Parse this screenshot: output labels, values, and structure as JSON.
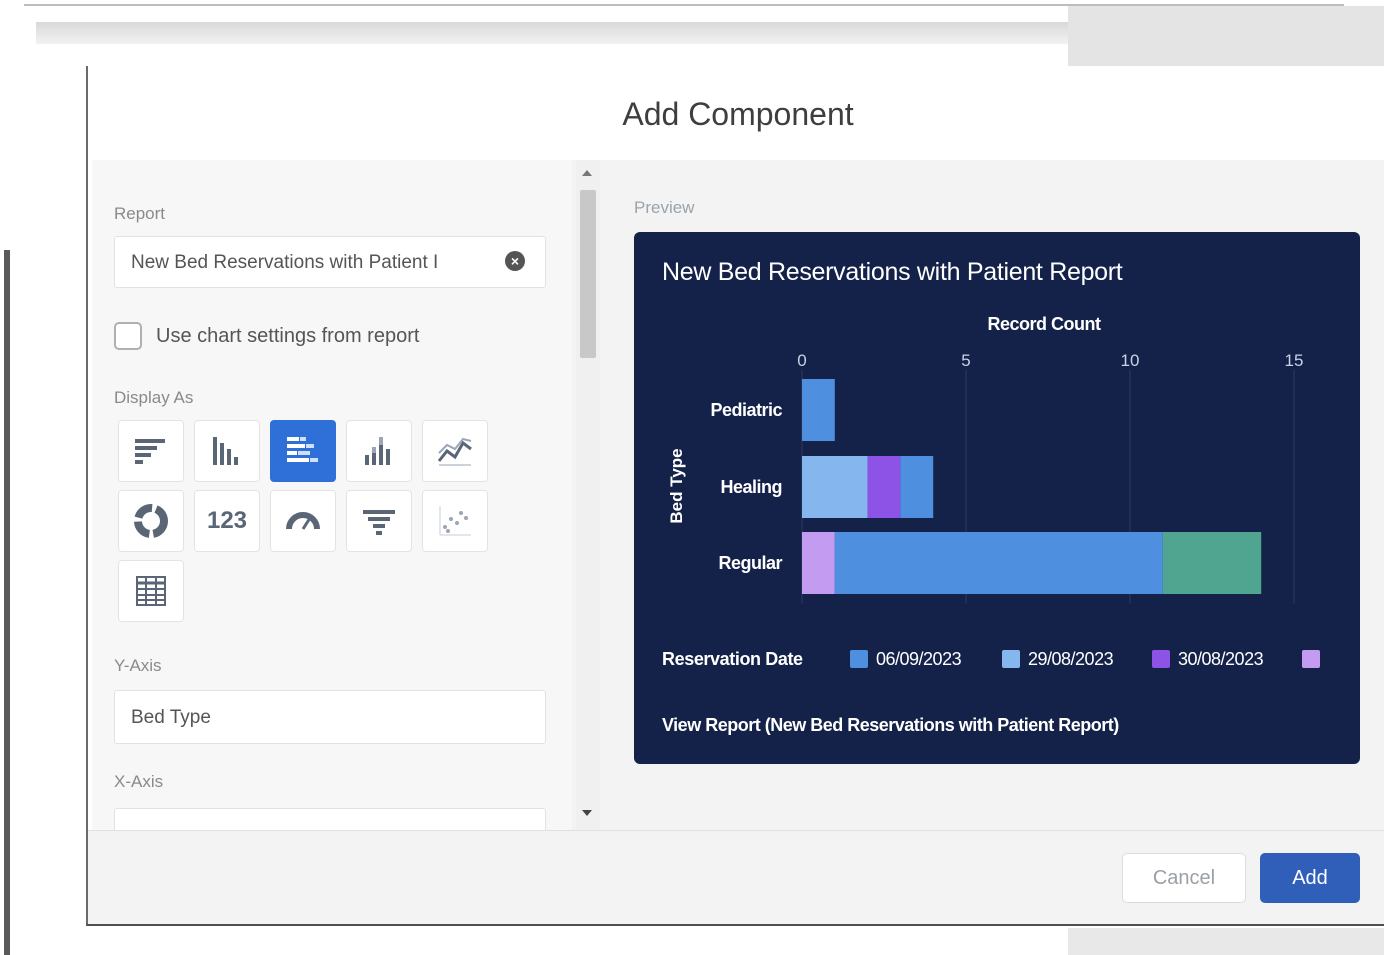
{
  "modal": {
    "title": "Add Component"
  },
  "form": {
    "report_label": "Report",
    "report_value": "New Bed Reservations with Patient I",
    "use_chart_settings_label": "Use chart settings from report",
    "display_as_label": "Display As",
    "display_as_options": [
      {
        "icon": "horizontal-bar-chart-icon",
        "selected": false
      },
      {
        "icon": "vertical-bar-chart-icon",
        "selected": false
      },
      {
        "icon": "stacked-horizontal-bar-chart-icon",
        "selected": true
      },
      {
        "icon": "stacked-vertical-bar-chart-icon",
        "selected": false
      },
      {
        "icon": "line-chart-icon",
        "selected": false
      },
      {
        "icon": "donut-chart-icon",
        "selected": false
      },
      {
        "icon": "metric-icon",
        "text": "123",
        "selected": false
      },
      {
        "icon": "gauge-icon",
        "selected": false
      },
      {
        "icon": "funnel-chart-icon",
        "selected": false
      },
      {
        "icon": "scatter-chart-icon",
        "selected": false
      },
      {
        "icon": "table-icon",
        "selected": false
      }
    ],
    "y_axis_label": "Y-Axis",
    "y_axis_value": "Bed Type",
    "x_axis_label": "X-Axis"
  },
  "preview": {
    "label": "Preview",
    "card_title": "New Bed Reservations with Patient Report",
    "legend_title": "Reservation Date",
    "legend": [
      {
        "label": "06/09/2023",
        "color": "#4f8fe0"
      },
      {
        "label": "29/08/2023",
        "color": "#86b6ee"
      },
      {
        "label": "30/08/2023",
        "color": "#8d52e6"
      },
      {
        "label": "",
        "color": "#c39cf2"
      }
    ],
    "view_report": "View Report (New Bed Reservations with Patient Report)"
  },
  "chart_data": {
    "type": "bar",
    "orientation": "horizontal",
    "stacked": true,
    "xlabel": "Record Count",
    "ylabel": "Bed Type",
    "xlim": [
      0,
      15
    ],
    "xticks": [
      0,
      5,
      10,
      15
    ],
    "categories": [
      "Pediatric",
      "Healing",
      "Regular"
    ],
    "segments": [
      [
        {
          "value": 1,
          "color": "#4f8fe0"
        }
      ],
      [
        {
          "value": 2,
          "color": "#86b6ee"
        },
        {
          "value": 1,
          "color": "#8d52e6"
        },
        {
          "value": 1,
          "color": "#4f8fe0"
        }
      ],
      [
        {
          "value": 1,
          "color": "#c39cf2"
        },
        {
          "value": 10,
          "color": "#4f8fe0"
        },
        {
          "value": 3,
          "color": "#4fa58f"
        }
      ]
    ],
    "grid": true
  },
  "footer": {
    "cancel_label": "Cancel",
    "add_label": "Add"
  }
}
